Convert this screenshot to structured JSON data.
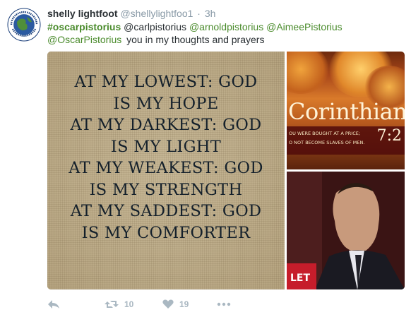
{
  "tweet": {
    "fullname": "shelly lightfoot",
    "screenname": "@shellylightfoo1",
    "separator": "·",
    "time": "3h",
    "text": {
      "hashtag": "#oscarpistorius",
      "mention1": "@carlpistorius",
      "mention2": "@arnoldpistorius",
      "mention3": "@AimeePistorius",
      "mention4": "@OscarPistorius",
      "body": "you in my thoughts and prayers"
    },
    "avatar_text": "Worldwide Support for Oscar Pistorius"
  },
  "media": {
    "quote_lines": [
      "AT MY LOWEST: GOD",
      "IS MY HOPE",
      "AT MY DARKEST: GOD",
      "IS MY LIGHT",
      "AT MY WEAKEST: GOD",
      "IS MY STRENGTH",
      "AT MY SADDEST: GOD",
      "IS MY COMFORTER"
    ],
    "corinthians_word": "Corinthian",
    "corinthians_line1": "OU WERE BOUGHT AT A PRICE;",
    "corinthians_line2": "O NOT BECOME SLAVES OF MEN.",
    "corinthians_ref": "7:2",
    "photo_badge": "LET"
  },
  "actions": {
    "reply_icon": "reply-icon",
    "retweet_icon": "retweet-icon",
    "retweet_count": "10",
    "like_icon": "heart-icon",
    "like_count": "19",
    "more_icon": "more-icon"
  },
  "colors": {
    "link": "#4a8b2c",
    "muted": "#8899a6",
    "action": "#aab8c2"
  }
}
